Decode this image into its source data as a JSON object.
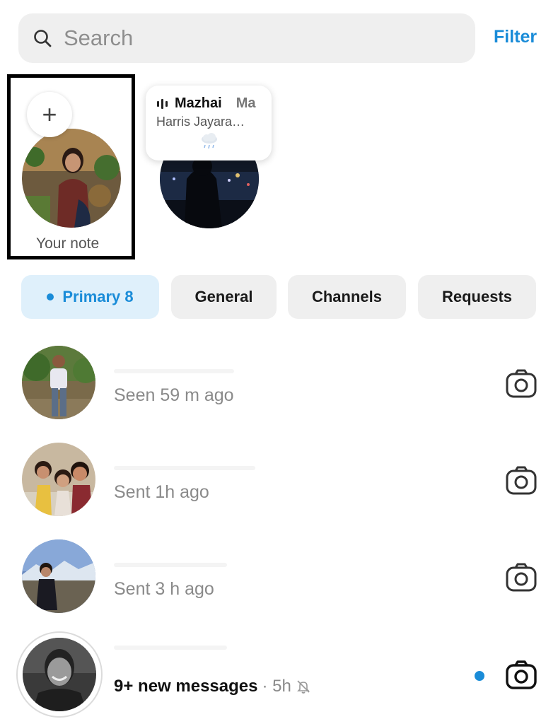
{
  "search": {
    "placeholder": "Search"
  },
  "header": {
    "filter_label": "Filter"
  },
  "notes": {
    "your_note_label": "Your note",
    "add_symbol": "+",
    "friend_note": {
      "song_title": "Mazhai",
      "song_title_2": "Ma",
      "artist": "Harris Jayara…"
    }
  },
  "tabs": [
    {
      "label": "Primary 8",
      "active": true
    },
    {
      "label": "General"
    },
    {
      "label": "Channels"
    },
    {
      "label": "Requests"
    }
  ],
  "chats": [
    {
      "status": "Seen 59 m ago"
    },
    {
      "status": "Sent 1h ago"
    },
    {
      "status": "Sent 3 h ago"
    },
    {
      "status": "9+ new messages",
      "time": "· 5h",
      "unread": true,
      "muted": true
    }
  ],
  "colors": {
    "accent": "#1a8cd8",
    "tab_bg": "#efefef",
    "active_tab_bg": "#dff0fb"
  }
}
